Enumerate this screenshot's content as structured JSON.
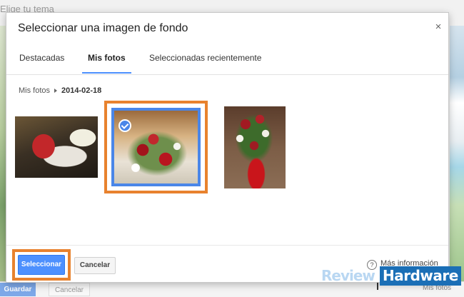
{
  "background": {
    "title": "Elige tu tema",
    "save_label": "Guardar",
    "cancel_label": "Cancelar",
    "link_label": "Mis fotos"
  },
  "dialog": {
    "title": "Seleccionar una imagen de fondo",
    "close_glyph": "×",
    "tabs": [
      {
        "label": "Destacadas",
        "active": false
      },
      {
        "label": "Mis fotos",
        "active": true
      },
      {
        "label": "Seleccionadas recientemente",
        "active": false
      }
    ],
    "breadcrumb": {
      "root": "Mis fotos",
      "current": "2014-02-18"
    },
    "photos": [
      {
        "subject": "can on tray",
        "selected": false
      },
      {
        "subject": "flower bouquet",
        "selected": true
      },
      {
        "subject": "rose bouquet",
        "selected": false
      }
    ],
    "buttons": {
      "select": "Seleccionar",
      "cancel": "Cancelar"
    },
    "help": {
      "icon_glyph": "?",
      "label": "Más información"
    }
  },
  "watermark": {
    "part1": "Review",
    "part2": "Hardware"
  },
  "colors": {
    "accent": "#4d90fe",
    "highlight": "#e8822e",
    "selected_border": "#4a86e8"
  }
}
